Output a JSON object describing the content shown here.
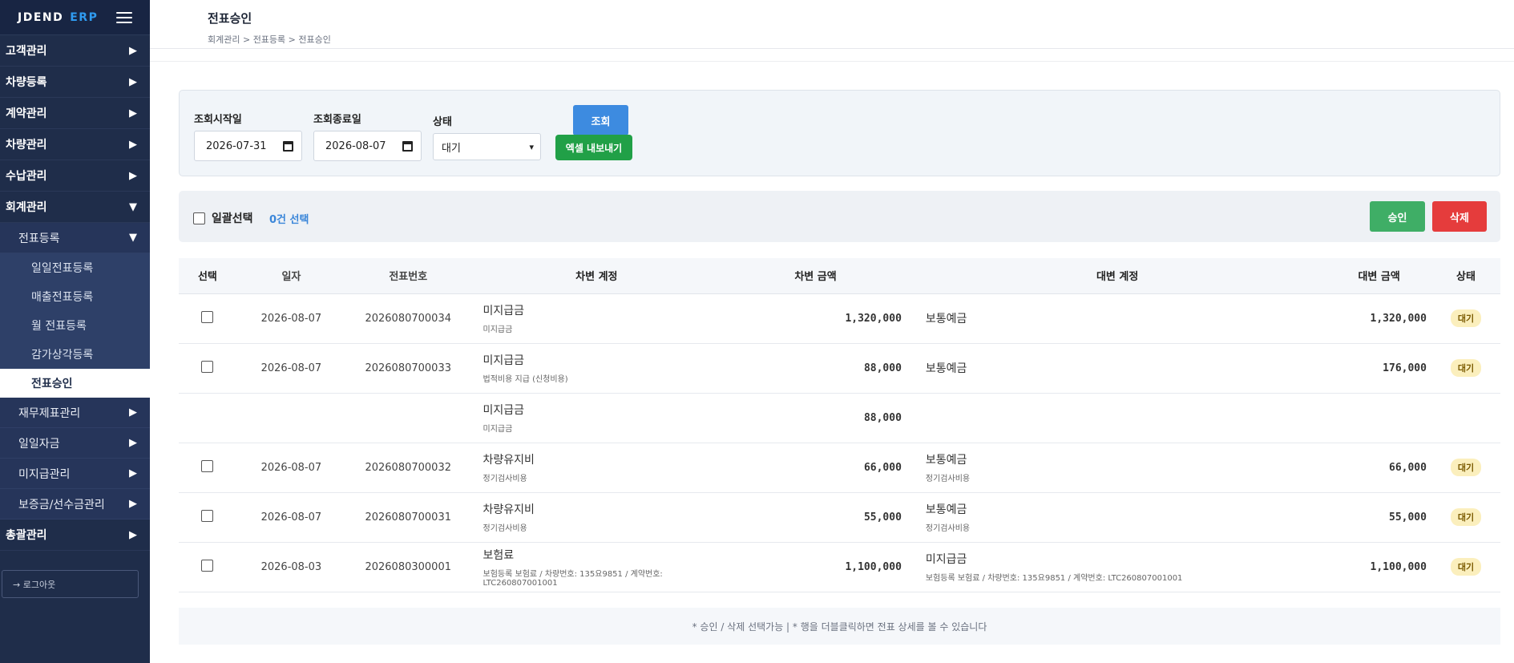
{
  "sidebar": {
    "logo_main": "JDEND",
    "logo_accent": "ERP",
    "menu": [
      {
        "label": "고객관리",
        "arrow": "▶"
      },
      {
        "label": "차량등록",
        "arrow": "▶"
      },
      {
        "label": "계약관리",
        "arrow": "▶"
      },
      {
        "label": "차량관리",
        "arrow": "▶"
      },
      {
        "label": "수납관리",
        "arrow": "▶"
      },
      {
        "label": "회계관리",
        "arrow": "▼"
      }
    ],
    "sub_menu": {
      "voucher_reg": {
        "label": "전표등록",
        "arrow": "▼"
      },
      "items": [
        "일일전표등록",
        "매출전표등록",
        "월 전표등록",
        "감가상각등록",
        "전표승인"
      ],
      "after": [
        {
          "label": "재무제표관리",
          "arrow": "▶"
        },
        {
          "label": "일일자금",
          "arrow": "▶"
        },
        {
          "label": "미지급관리",
          "arrow": "▶"
        },
        {
          "label": "보증금/선수금관리",
          "arrow": "▶"
        }
      ]
    },
    "general": {
      "label": "총괄관리",
      "arrow": "▶"
    },
    "logout": "→ 로그아웃"
  },
  "header": {
    "title": "전표승인",
    "breadcrumb": "회계관리 > 전표등록 > 전표승인"
  },
  "filter": {
    "start_label": "조회시작일",
    "start_value": "2026-07-31",
    "end_label": "조회종료일",
    "end_value": "2026-08-07",
    "status_label": "상태",
    "status_value": "대기",
    "search_button": "조회",
    "excel_button": "엑셀 내보내기"
  },
  "actions": {
    "bulk_label": "일괄선택",
    "selected_count": "0건 선택",
    "approve": "승인",
    "delete": "삭제"
  },
  "table": {
    "headers": [
      "선택",
      "일자",
      "전표번호",
      "차변 계정",
      "차변 금액",
      "대변 계정",
      "대변 금액",
      "상태"
    ],
    "rows": [
      {
        "date": "2026-08-07",
        "no": "2026080700034",
        "debit": "미지급금",
        "debit_sub": "미지급금",
        "debit_amt": "1,320,000",
        "credit": "보통예금",
        "credit_sub": "",
        "credit_amt": "1,320,000",
        "status": "대기"
      },
      {
        "date": "2026-08-07",
        "no": "2026080700033",
        "debit": "미지급금",
        "debit_sub": "법적비용 지급 (신청비용)",
        "debit_amt": "88,000",
        "credit": "보통예금",
        "credit_sub": "",
        "credit_amt": "176,000",
        "status": "대기"
      },
      {
        "date": "",
        "no": "",
        "debit": "미지급금",
        "debit_sub": "미지급금",
        "debit_amt": "88,000",
        "credit": "",
        "credit_sub": "",
        "credit_amt": "",
        "status": ""
      },
      {
        "date": "2026-08-07",
        "no": "2026080700032",
        "debit": "차량유지비",
        "debit_sub": "정기검사비용",
        "debit_amt": "66,000",
        "credit": "보통예금",
        "credit_sub": "정기검사비용",
        "credit_amt": "66,000",
        "status": "대기"
      },
      {
        "date": "2026-08-07",
        "no": "2026080700031",
        "debit": "차량유지비",
        "debit_sub": "정기검사비용",
        "debit_amt": "55,000",
        "credit": "보통예금",
        "credit_sub": "정기검사비용",
        "credit_amt": "55,000",
        "status": "대기"
      },
      {
        "date": "2026-08-03",
        "no": "2026080300001",
        "debit": "보험료",
        "debit_sub": "보험등록 보험료 / 차량번호: 135요9851 / 계약번호: LTC260807001001",
        "debit_amt": "1,100,000",
        "credit": "미지급금",
        "credit_sub": "보험등록 보험료 / 차량번호: 135요9851 / 계약번호: LTC260807001001",
        "credit_amt": "1,100,000",
        "status": "대기"
      }
    ]
  },
  "footnote": "* 승인 / 삭제 선택가능  |  * 행을 더블클릭하면 전표 상세를 볼 수 있습니다"
}
